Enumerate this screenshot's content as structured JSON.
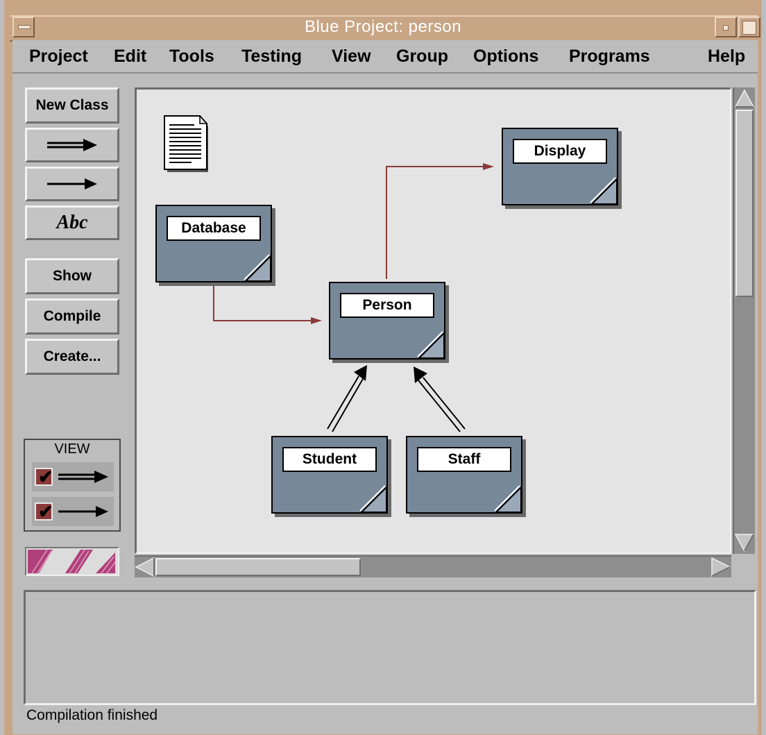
{
  "window": {
    "title": "Blue Project: person"
  },
  "menu": {
    "project": "Project",
    "edit": "Edit",
    "tools": "Tools",
    "testing": "Testing",
    "view": "View",
    "group": "Group",
    "options": "Options",
    "programs": "Programs",
    "help": "Help"
  },
  "tools": {
    "new_class": "New Class",
    "text_tool": "Abc",
    "show": "Show",
    "compile": "Compile",
    "create": "Create..."
  },
  "view_panel": {
    "label": "VIEW",
    "inheritance_checked": true,
    "uses_checked": true
  },
  "classes": {
    "database": "Database",
    "display": "Display",
    "person": "Person",
    "student": "Student",
    "staff": "Staff"
  },
  "status": {
    "message": "Compilation finished"
  },
  "colors": {
    "class_box": "#778899",
    "canvas": "#e4e4e4",
    "uses_arrow": "#8b3a3a",
    "title_bar": "#c8a585"
  }
}
